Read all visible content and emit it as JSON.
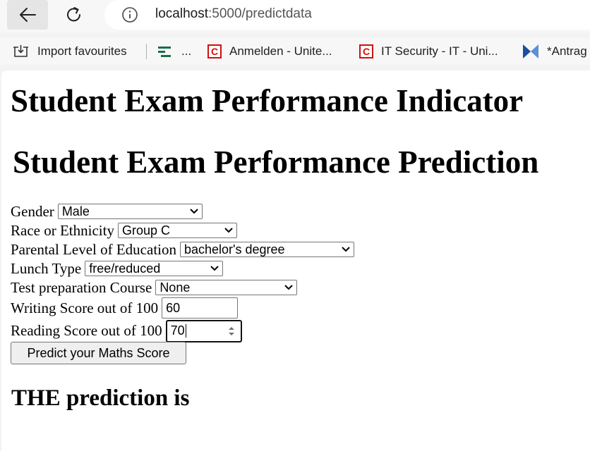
{
  "browser": {
    "url_host": "localhost",
    "url_path": ":5000/predictdata",
    "bookmarks": [
      {
        "label": "Import favourites",
        "icon": "import-favourites-icon"
      },
      {
        "label": "...",
        "icon": "green-bars-icon"
      },
      {
        "label": "Anmelden - Unite...",
        "icon": "c-logo-icon"
      },
      {
        "label": "IT Security - IT - Uni...",
        "icon": "c-logo-icon"
      },
      {
        "label": "*Antrag",
        "icon": "blue-k-icon"
      }
    ]
  },
  "page": {
    "title": "Student Exam Performance Indicator",
    "subtitle": "Student Exam Performance Prediction",
    "form": {
      "gender_label": "Gender",
      "gender_value": "Male",
      "race_label": "Race or Ethnicity",
      "race_value": "Group C",
      "parental_label": "Parental Level of Education",
      "parental_value": "bachelor's degree",
      "lunch_label": "Lunch Type",
      "lunch_value": "free/reduced",
      "prep_label": "Test preparation Course",
      "prep_value": "None",
      "writing_label": "Writing Score out of 100",
      "writing_value": "60",
      "reading_label": "Reading Score out of 100",
      "reading_value": "70",
      "submit_label": "Predict your Maths Score"
    },
    "result_heading": "THE prediction is"
  }
}
